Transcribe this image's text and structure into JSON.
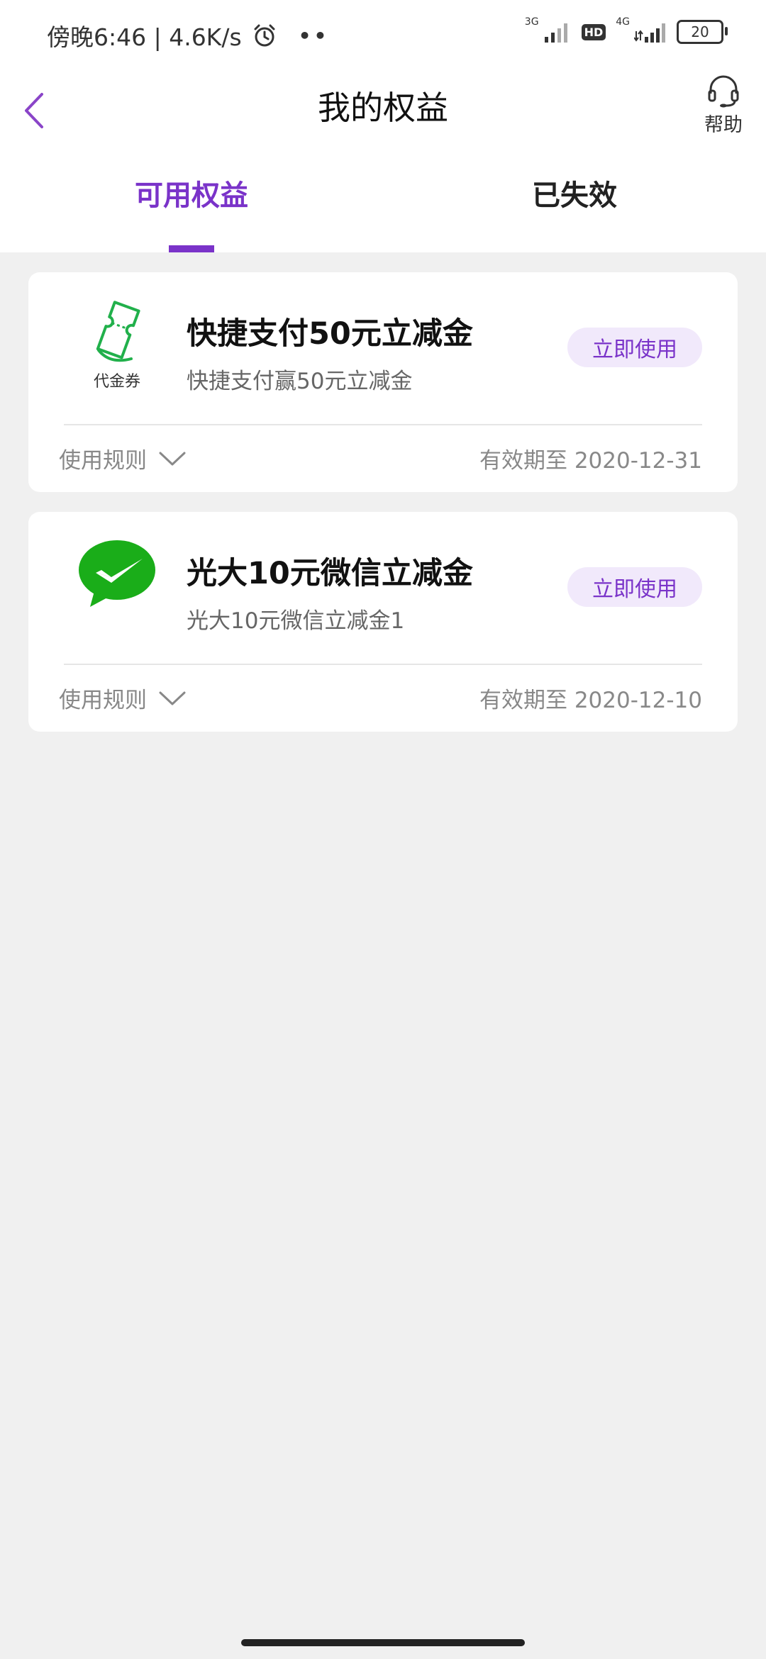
{
  "status_bar": {
    "time_speed": "傍晚6:46 | 4.6K/s",
    "net_3g": "3G",
    "hd": "HD",
    "net_4g": "4G",
    "battery": "20"
  },
  "header": {
    "title": "我的权益",
    "help_label": "帮助"
  },
  "tabs": [
    {
      "label": "可用权益",
      "active": true
    },
    {
      "label": "已失效",
      "active": false
    }
  ],
  "coupons": [
    {
      "icon": "voucher-ticket-icon",
      "icon_caption": "代金券",
      "title": "快捷支付50元立减金",
      "subtitle": "快捷支付赢50元立减金",
      "button": "立即使用",
      "rules_label": "使用规则",
      "expiry": "有效期至 2020-12-31"
    },
    {
      "icon": "wechat-icon",
      "title": "光大10元微信立减金",
      "subtitle": "光大10元微信立减金1",
      "button": "立即使用",
      "rules_label": "使用规则",
      "expiry": "有效期至 2020-12-10"
    }
  ],
  "colors": {
    "accent": "#7a33c9",
    "accent_light": "#f1e9fb",
    "wechat_green": "#1aad19",
    "voucher_green": "#21b04b",
    "background": "#f0f0f0"
  }
}
